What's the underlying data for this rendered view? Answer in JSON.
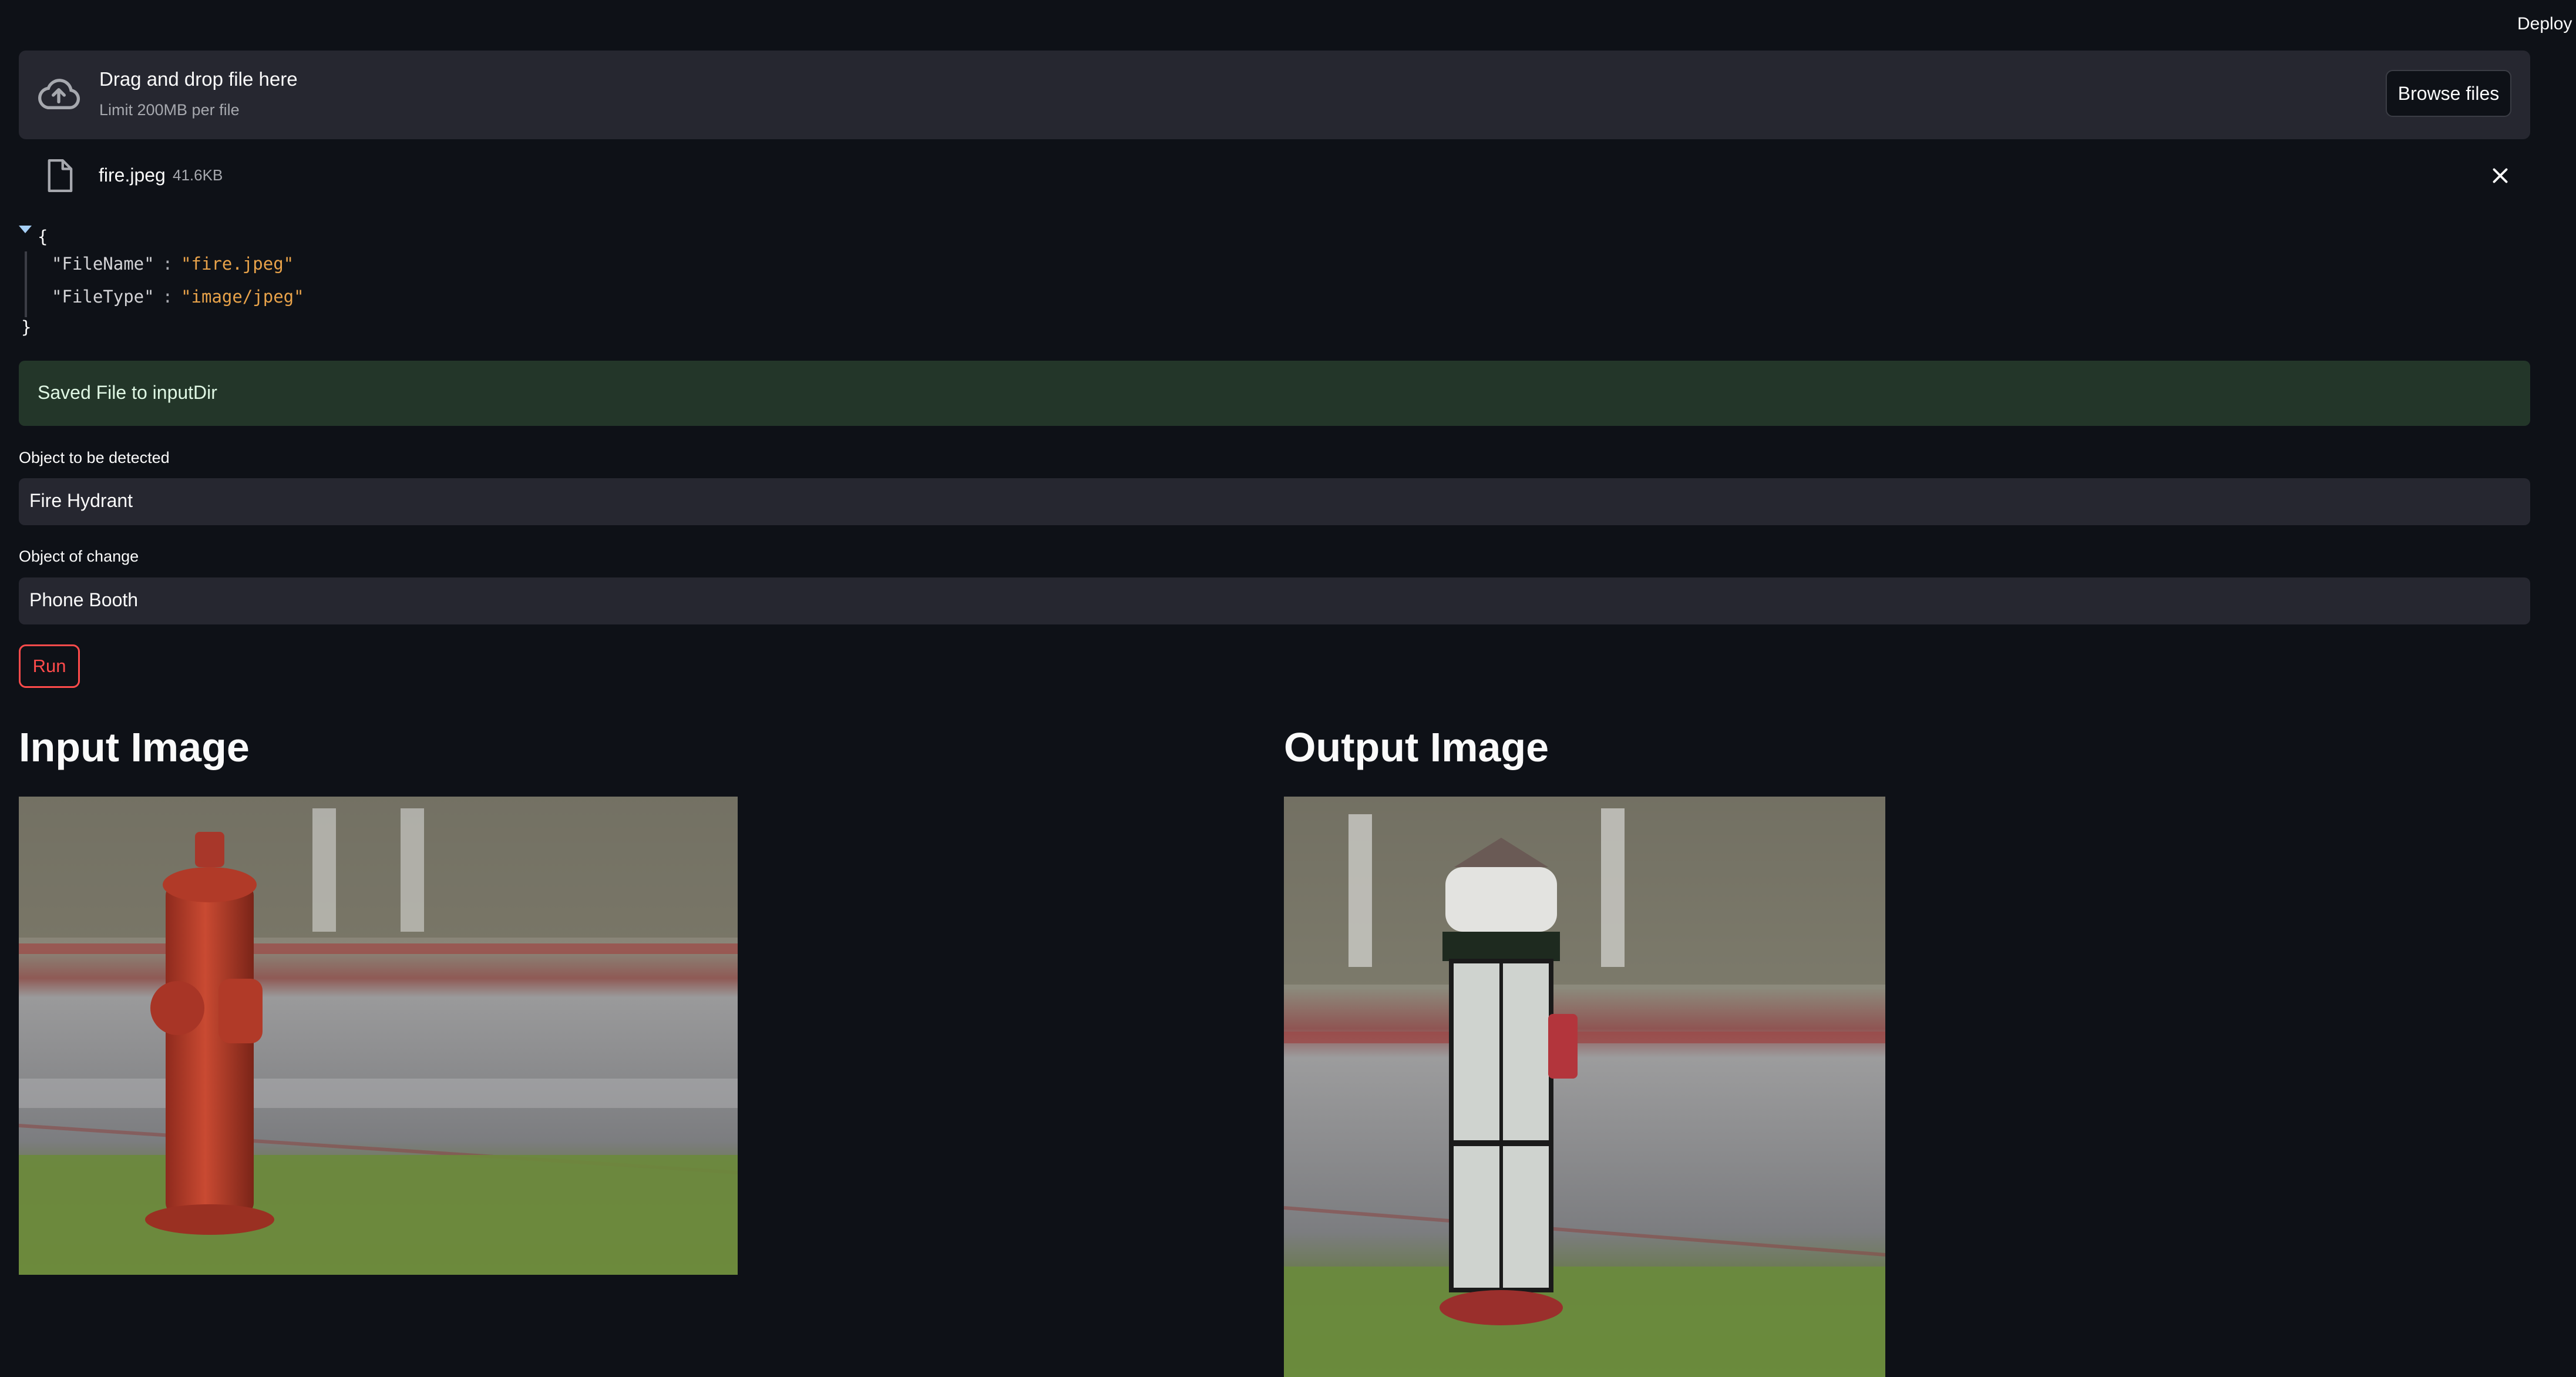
{
  "header": {
    "deploy_label": "Deploy"
  },
  "uploader": {
    "title": "Drag and drop file here",
    "subtitle": "Limit 200MB per file",
    "browse_label": "Browse files"
  },
  "file": {
    "name": "fire.jpeg",
    "size": "41.6KB"
  },
  "json_view": {
    "open_brace": "{",
    "close_brace": "}",
    "entries": [
      {
        "key": "\"FileName\"",
        "sep": ":",
        "value": "\"fire.jpeg\""
      },
      {
        "key": "\"FileType\"",
        "sep": ":",
        "value": "\"image/jpeg\""
      }
    ]
  },
  "success_message": "Saved File to inputDir",
  "form": {
    "detect_label": "Object to be detected",
    "detect_value": "Fire Hydrant",
    "change_label": "Object of change",
    "change_value": "Phone Booth",
    "run_label": "Run"
  },
  "results": {
    "input_heading": "Input Image",
    "output_heading": "Output Image",
    "input_image": "fire-hydrant-photo",
    "output_image": "phone-booth-edited-photo"
  },
  "colors": {
    "background": "#0e1117",
    "surface": "#262730",
    "accent": "#ff4b4b",
    "success_bg": "#233629"
  }
}
